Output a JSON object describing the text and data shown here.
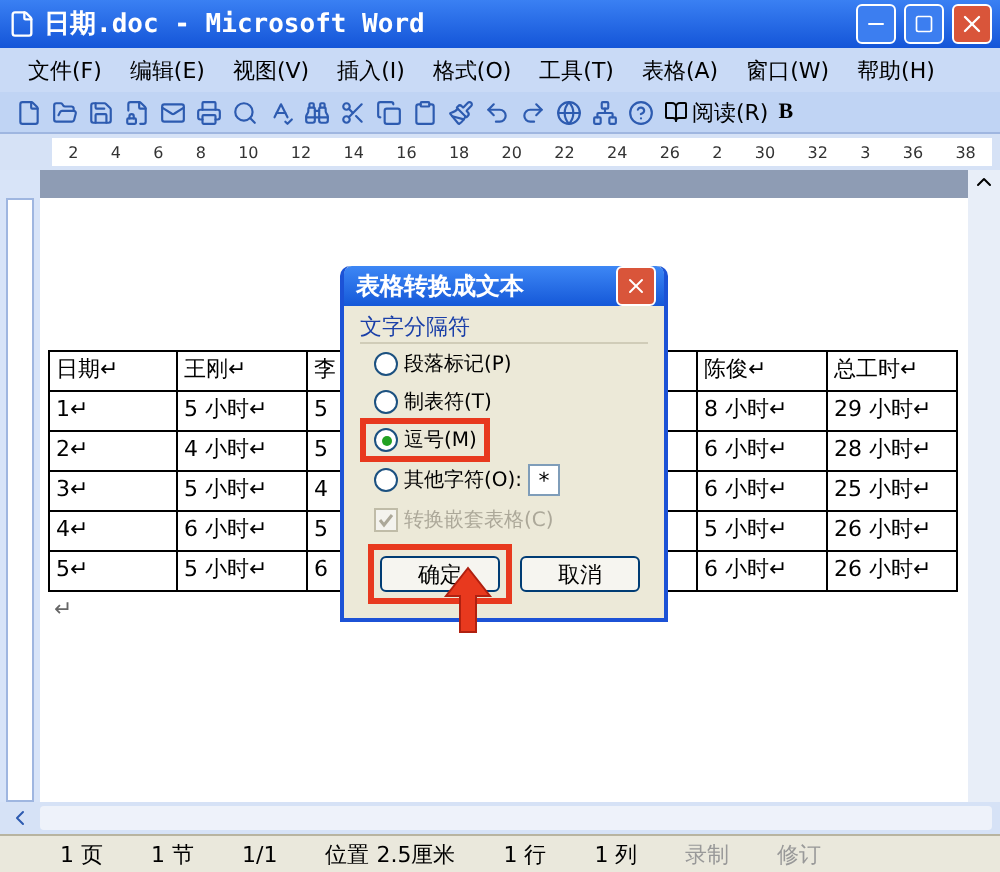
{
  "window": {
    "title": "日期.doc - Microsoft Word"
  },
  "menu": [
    "文件(F)",
    "编辑(E)",
    "视图(V)",
    "插入(I)",
    "格式(O)",
    "工具(T)",
    "表格(A)",
    "窗口(W)",
    "帮助(H)"
  ],
  "toolbar": {
    "read_button": "阅读(R)",
    "bold_button": "B"
  },
  "ruler": [
    "2",
    "4",
    "6",
    "8",
    "10",
    "12",
    "14",
    "16",
    "18",
    "20",
    "22",
    "24",
    "26",
    "2",
    "30",
    "32",
    "3",
    "36",
    "38"
  ],
  "table": {
    "rows": [
      [
        "日期↵",
        "王刚↵",
        "李",
        "陈俊↵",
        "总工时↵"
      ],
      [
        "1↵",
        "5 小时↵",
        "5",
        "8 小时↵",
        "29 小时↵"
      ],
      [
        "2↵",
        "4 小时↵",
        "5",
        "6 小时↵",
        "28 小时↵"
      ],
      [
        "3↵",
        "5 小时↵",
        "4",
        "6 小时↵",
        "25 小时↵"
      ],
      [
        "4↵",
        "6 小时↵",
        "5",
        "5 小时↵",
        "26 小时↵"
      ],
      [
        "5↵",
        "5 小时↵",
        "6",
        "6 小时↵",
        "26 小时↵"
      ]
    ]
  },
  "after_table": "↵",
  "dialog": {
    "title": "表格转换成文本",
    "group": "文字分隔符",
    "options": [
      {
        "label": "段落标记(P)",
        "selected": false
      },
      {
        "label": "制表符(T)",
        "selected": false
      },
      {
        "label": "逗号(M)",
        "selected": true
      },
      {
        "label": "其他字符(O):",
        "selected": false
      }
    ],
    "other_value": "*",
    "nested": {
      "label": "转换嵌套表格(C)",
      "checked": true,
      "disabled": true
    },
    "ok": "确定",
    "cancel": "取消"
  },
  "status_bar": [
    "1 页",
    "1 节",
    "1/1",
    "位置 2.5厘米",
    "1 行",
    "1 列",
    "录制",
    "修订"
  ]
}
